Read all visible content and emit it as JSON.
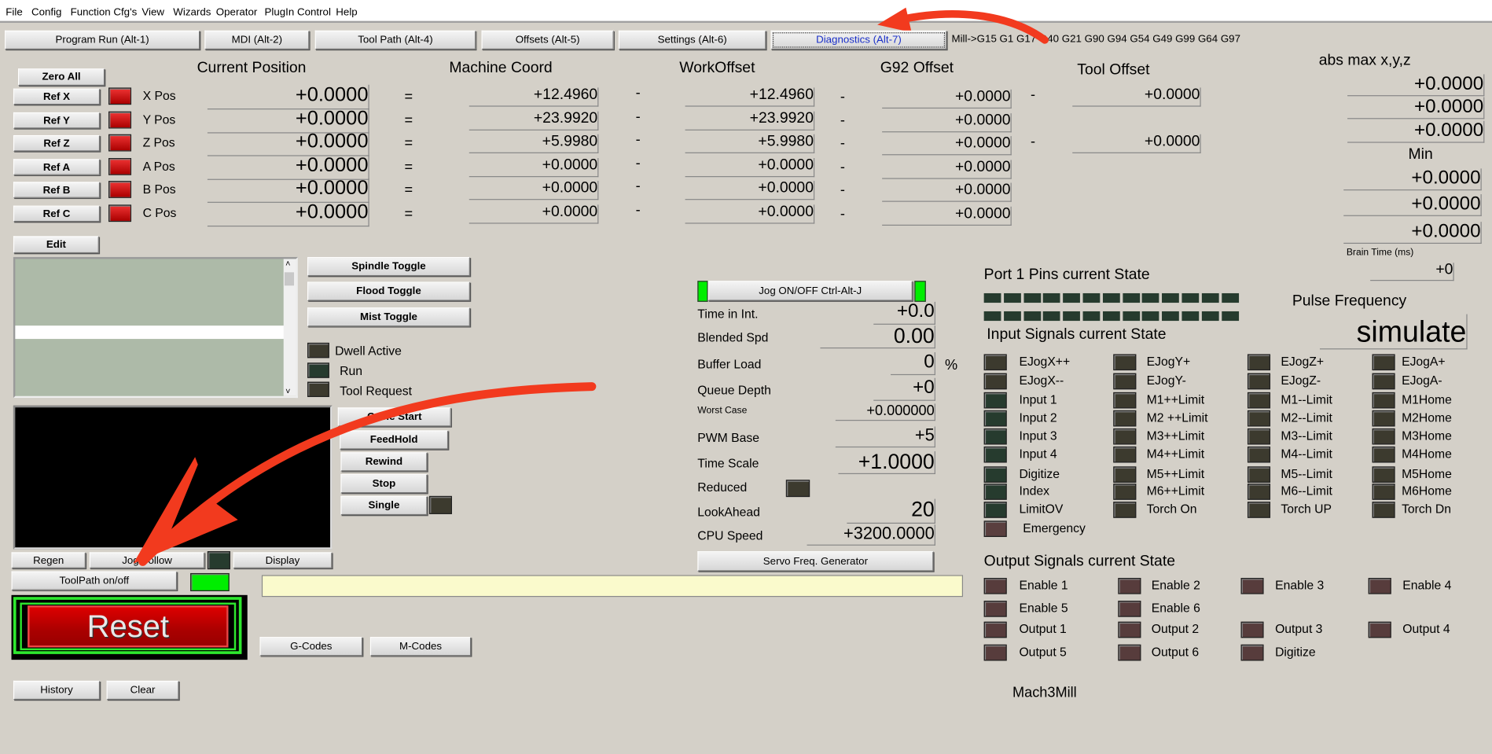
{
  "menu": [
    "File",
    "Config",
    "Function Cfg's",
    "View",
    "Wizards",
    "Operator",
    "PlugIn Control",
    "Help"
  ],
  "tabs": [
    {
      "label": "Program Run (Alt-1)",
      "selected": false
    },
    {
      "label": "MDI (Alt-2)",
      "selected": false
    },
    {
      "label": "Tool Path (Alt-4)",
      "selected": false
    },
    {
      "label": "Offsets (Alt-5)",
      "selected": false
    },
    {
      "label": "Settings (Alt-6)",
      "selected": false
    },
    {
      "label": "Diagnostics (Alt-7)",
      "selected": true
    }
  ],
  "mode_line": "Mill->G15  G1 G17 G40 G21 G90 G94 G54 G49 G99 G64 G97",
  "headers": {
    "current": "Current Position",
    "machine": "Machine Coord",
    "work": "WorkOffset",
    "g92": "G92 Offset",
    "tool": "Tool Offset",
    "absmax": "abs max x,y,z",
    "min": "Min",
    "brain": "Brain Time (ms)"
  },
  "zero_all": "Zero All",
  "axes": [
    {
      "ref": "Ref X",
      "label": "X Pos",
      "current": "+0.0000",
      "machine": "+12.4960",
      "work": "+12.4960",
      "g92": "+0.0000",
      "tool": "+0.0000"
    },
    {
      "ref": "Ref Y",
      "label": "Y Pos",
      "current": "+0.0000",
      "machine": "+23.9920",
      "work": "+23.9920",
      "g92": "+0.0000"
    },
    {
      "ref": "Ref Z",
      "label": "Z Pos",
      "current": "+0.0000",
      "machine": "+5.9980",
      "work": "+5.9980",
      "g92": "+0.0000",
      "tool": "+0.0000"
    },
    {
      "ref": "Ref A",
      "label": "A Pos",
      "current": "+0.0000",
      "machine": "+0.0000",
      "work": "+0.0000",
      "g92": "+0.0000"
    },
    {
      "ref": "Ref B",
      "label": "B Pos",
      "current": "+0.0000",
      "machine": "+0.0000",
      "work": "+0.0000",
      "g92": "+0.0000"
    },
    {
      "ref": "Ref C",
      "label": "C Pos",
      "current": "+0.0000",
      "machine": "+0.0000",
      "work": "+0.0000",
      "g92": "+0.0000"
    }
  ],
  "eq": "=",
  "minus": "-",
  "absmax": [
    "+0.0000",
    "+0.0000",
    "+0.0000"
  ],
  "min": [
    "+0.0000",
    "+0.0000",
    "+0.0000"
  ],
  "brain_time": "+0",
  "buttons": {
    "edit": "Edit",
    "spindle": "Spindle Toggle",
    "flood": "Flood Toggle",
    "mist": "Mist Toggle",
    "cycle": "Cycle Start",
    "feedhold": "FeedHold",
    "rewind": "Rewind",
    "stop": "Stop",
    "single": "Single",
    "regen": "Regen",
    "jogfollow": "Jog Follow",
    "display": "Display",
    "toolpath": "ToolPath on/off",
    "reset": "Reset",
    "gcodes": "G-Codes",
    "mcodes": "M-Codes",
    "history": "History",
    "clear": "Clear",
    "jog": "Jog ON/OFF Ctrl-Alt-J",
    "servo": "Servo Freq. Generator"
  },
  "status_leds": [
    "Dwell Active",
    "Run",
    "Tool Request"
  ],
  "mdi_input": "",
  "diag": [
    {
      "label": "Time in Int.",
      "value": "+0.0"
    },
    {
      "label": "Blended Spd",
      "value": "0.00"
    },
    {
      "label": "Buffer Load",
      "value": "0",
      "unit": "%"
    },
    {
      "label": "Queue Depth",
      "value": "+0"
    },
    {
      "label": "Worst Case",
      "value": "+0.000000"
    },
    {
      "label": "PWM Base",
      "value": "+5"
    },
    {
      "label": "Time Scale",
      "value": "+1.0000"
    },
    {
      "label": "Reduced"
    },
    {
      "label": "LookAhead",
      "value": "20"
    },
    {
      "label": "CPU Speed",
      "value": "+3200.0000"
    }
  ],
  "port_title": "Port 1 Pins current State",
  "pulse_title": "Pulse Frequency",
  "pulse_value": "simulate",
  "input_title": "Input Signals current State",
  "inputs": [
    [
      "EJogX++",
      "EJogX--",
      "Input 1",
      "Input 2",
      "Input 3",
      "Input 4",
      "Digitize",
      "Index",
      "LimitOV",
      "Emergency"
    ],
    [
      "EJogY+",
      "EJogY-",
      "M1++Limit",
      "M2 ++Limit",
      "M3++Limit",
      "M4++Limit",
      "M5++Limit",
      "M6++Limit",
      "Torch On"
    ],
    [
      "EJogZ+",
      "EJogZ-",
      "M1--Limit",
      "M2--Limit",
      "M3--Limit",
      "M4--Limit",
      "M5--Limit",
      "M6--Limit",
      "Torch UP"
    ],
    [
      "EJogA+",
      "EJogA-",
      "M1Home",
      "M2Home",
      "M3Home",
      "M4Home",
      "M5Home",
      "M6Home",
      "Torch Dn"
    ]
  ],
  "output_title": "Output Signals current State",
  "outputs": [
    [
      "Enable 1",
      "Enable 5",
      "Output 1",
      "Output 5"
    ],
    [
      "Enable 2",
      "Enable 6",
      "Output 2",
      "Output 6"
    ],
    [
      "Enable 3",
      "",
      "Output 3",
      "Digitize"
    ],
    [
      "Enable 4",
      "",
      "Output 4",
      ""
    ]
  ],
  "profile": "Mach3Mill",
  "colors": {
    "background": "#d4d0c8",
    "led_red": "#cc1111",
    "led_green": "#00ee00",
    "led_off_green": "#263b2e",
    "led_off_olive": "#3c3a2e",
    "led_off_output": "#573c3c",
    "mdi_bg": "#fafacc",
    "reset_red": "#b00000",
    "annotation_arrow": "#f23a1e"
  }
}
